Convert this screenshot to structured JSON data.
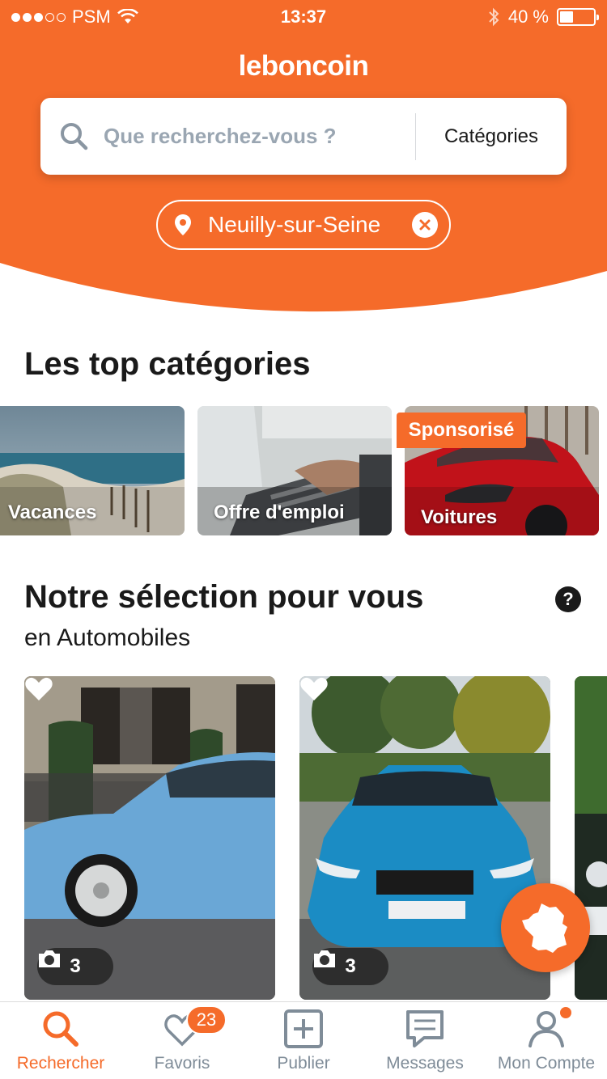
{
  "status_bar": {
    "carrier": "PSM",
    "time": "13:37",
    "battery": "40 %",
    "battery_level": 0.4
  },
  "header": {
    "logo": "leboncoin",
    "search_placeholder": "Que recherchez-vous ?",
    "categories_label": "Catégories",
    "location": "Neuilly-sur-Seine"
  },
  "top_categories": {
    "title": "Les top catégories",
    "items": [
      {
        "label": "Vacances"
      },
      {
        "label": "Offre d'emploi"
      },
      {
        "label": "Voitures",
        "badge": "Sponsorisé"
      }
    ]
  },
  "selection": {
    "title": "Notre sélection pour vous",
    "subtitle": "en Automobiles",
    "help_glyph": "?",
    "ads": [
      {
        "photo_count": "3"
      },
      {
        "photo_count": "3"
      }
    ]
  },
  "bottom_nav": {
    "items": [
      {
        "label": "Rechercher",
        "icon": "search-icon"
      },
      {
        "label": "Favoris",
        "icon": "heart-icon",
        "badge": "23"
      },
      {
        "label": "Publier",
        "icon": "plus-square-icon"
      },
      {
        "label": "Messages",
        "icon": "message-icon"
      },
      {
        "label": "Mon Compte",
        "icon": "user-icon"
      }
    ]
  },
  "colors": {
    "brand_orange": "#f56b2a",
    "text_dark": "#1a1a1a",
    "nav_gray": "#7f8c98"
  }
}
